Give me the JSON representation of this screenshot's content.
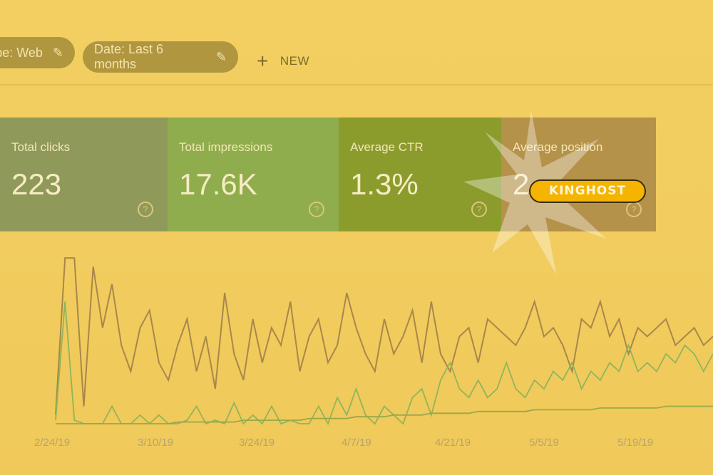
{
  "filters": [
    {
      "label": "pe: Web",
      "icon": "pencil-icon"
    },
    {
      "label": "Date: Last 6 months",
      "icon": "pencil-icon"
    }
  ],
  "new_button": {
    "label": "NEW",
    "icon": "plus-icon"
  },
  "cards": [
    {
      "label": "Total clicks",
      "value": "223",
      "color": "#8f9a5a"
    },
    {
      "label": "Total impressions",
      "value": "17.6K",
      "color": "#8fad4c"
    },
    {
      "label": "Average CTR",
      "value": "1.3%",
      "color": "#8b9c2d"
    },
    {
      "label": "Average position",
      "value": "2",
      "color": "#b5924a"
    }
  ],
  "badge": {
    "text": "KINGHOST"
  },
  "chart_data": {
    "type": "line",
    "x_ticks": [
      "2/24/19",
      "3/10/19",
      "3/24/19",
      "4/7/19",
      "4/21/19",
      "5/5/19",
      "5/19/19"
    ],
    "series": [
      {
        "color": "#a8874a",
        "values": [
          0.05,
          0.95,
          0.95,
          0.1,
          0.9,
          0.55,
          0.8,
          0.45,
          0.3,
          0.55,
          0.65,
          0.35,
          0.25,
          0.45,
          0.6,
          0.3,
          0.5,
          0.2,
          0.75,
          0.4,
          0.25,
          0.6,
          0.35,
          0.55,
          0.45,
          0.7,
          0.3,
          0.5,
          0.6,
          0.35,
          0.45,
          0.75,
          0.55,
          0.4,
          0.3,
          0.6,
          0.4,
          0.5,
          0.65,
          0.35,
          0.7,
          0.4,
          0.3,
          0.5,
          0.55,
          0.35,
          0.6,
          0.55,
          0.5,
          0.45,
          0.55,
          0.7,
          0.5,
          0.55,
          0.45,
          0.3,
          0.6,
          0.55,
          0.7,
          0.5,
          0.6,
          0.4,
          0.55,
          0.5,
          0.55,
          0.6,
          0.45,
          0.5,
          0.55,
          0.45,
          0.5
        ]
      },
      {
        "color": "#8fb55a",
        "values": [
          0.02,
          0.7,
          0.02,
          0.0,
          0.0,
          0.0,
          0.1,
          0.0,
          0.0,
          0.05,
          0.0,
          0.05,
          0.0,
          0.0,
          0.02,
          0.1,
          0.0,
          0.02,
          0.0,
          0.12,
          0.0,
          0.05,
          0.0,
          0.1,
          0.0,
          0.02,
          0.0,
          0.0,
          0.1,
          0.0,
          0.15,
          0.05,
          0.2,
          0.05,
          0.0,
          0.1,
          0.05,
          0.0,
          0.15,
          0.2,
          0.05,
          0.25,
          0.35,
          0.2,
          0.15,
          0.25,
          0.15,
          0.2,
          0.35,
          0.2,
          0.15,
          0.25,
          0.2,
          0.3,
          0.25,
          0.35,
          0.2,
          0.3,
          0.25,
          0.35,
          0.3,
          0.45,
          0.3,
          0.35,
          0.3,
          0.4,
          0.35,
          0.45,
          0.4,
          0.3,
          0.4
        ]
      },
      {
        "color": "#9aa84a",
        "values": [
          0.0,
          0.0,
          0.0,
          0.0,
          0.0,
          0.0,
          0.0,
          0.0,
          0.0,
          0.0,
          0.0,
          0.0,
          0.0,
          0.01,
          0.01,
          0.01,
          0.01,
          0.01,
          0.01,
          0.01,
          0.02,
          0.02,
          0.02,
          0.02,
          0.02,
          0.02,
          0.02,
          0.03,
          0.03,
          0.03,
          0.03,
          0.03,
          0.04,
          0.04,
          0.04,
          0.04,
          0.05,
          0.05,
          0.05,
          0.05,
          0.06,
          0.06,
          0.06,
          0.06,
          0.06,
          0.07,
          0.07,
          0.07,
          0.07,
          0.07,
          0.07,
          0.08,
          0.08,
          0.08,
          0.08,
          0.08,
          0.08,
          0.08,
          0.09,
          0.09,
          0.09,
          0.09,
          0.09,
          0.09,
          0.09,
          0.1,
          0.1,
          0.1,
          0.1,
          0.1,
          0.1
        ]
      }
    ]
  }
}
